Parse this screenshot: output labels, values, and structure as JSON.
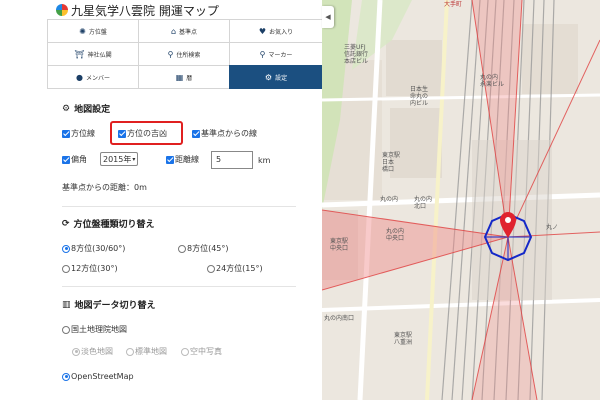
{
  "app": {
    "title": "九星気学八雲院 開運マップ"
  },
  "nav": {
    "items": [
      {
        "label": "方位盤",
        "icon": "compass-icon"
      },
      {
        "label": "基準点",
        "icon": "home-icon"
      },
      {
        "label": "お気入り",
        "icon": "heart-icon"
      },
      {
        "label": "神社仏閣",
        "icon": "torii-icon"
      },
      {
        "label": "住所検索",
        "icon": "search-icon"
      },
      {
        "label": "マーカー",
        "icon": "map-pin-icon"
      },
      {
        "label": "メンバー",
        "icon": "user-icon"
      },
      {
        "label": "暦",
        "icon": "calendar-icon"
      },
      {
        "label": "設定",
        "icon": "gear-icon"
      }
    ],
    "active_index": 8
  },
  "map_settings": {
    "title": "地図設定",
    "direction_lines_label": "方位線",
    "direction_fortune_label": "方位の吉凶",
    "base_lines_label": "基準点からの線",
    "declination_label": "偏角",
    "declination_year": "2015年",
    "distance_line_label": "距離線",
    "distance_value": "5",
    "distance_unit": "km",
    "distance_from_base_label": "基準点からの距離：0m"
  },
  "direction_board": {
    "title": "方位盤種類切り替え",
    "options": [
      "8方位(30/60°)",
      "8方位(45°)",
      "12方位(30°)",
      "24方位(15°)"
    ],
    "selected_index": 0
  },
  "map_data": {
    "title": "地図データ切り替え",
    "gsi_label": "国土地理院地図",
    "gsi_sub_options": [
      "淡色地図",
      "標準地図",
      "空中写真"
    ],
    "osm_label": "OpenStreetMap",
    "selected": "OpenStreetMap"
  },
  "map": {
    "labels": [
      "大手町",
      "三菱UFJ",
      "信託銀行",
      "本店ビル",
      "丸の内",
      "永楽ビル",
      "日本生",
      "命丸の",
      "内ビル",
      "東京駅",
      "日本",
      "橋口",
      "丸の内",
      "丸の内",
      "北口",
      "丸の内",
      "中央口",
      "東京駅",
      "中央口",
      "丸の内南口",
      "東京駅",
      "八重洲",
      "丸ノ"
    ]
  },
  "colors": {
    "nav_active": "#1b4f80",
    "checkbox": "#1a73e8",
    "highlight_border": "#e02020",
    "sector_fill": "#f08a8a",
    "compass_hexagon": "#1428c8",
    "marker": "#e0232e"
  }
}
